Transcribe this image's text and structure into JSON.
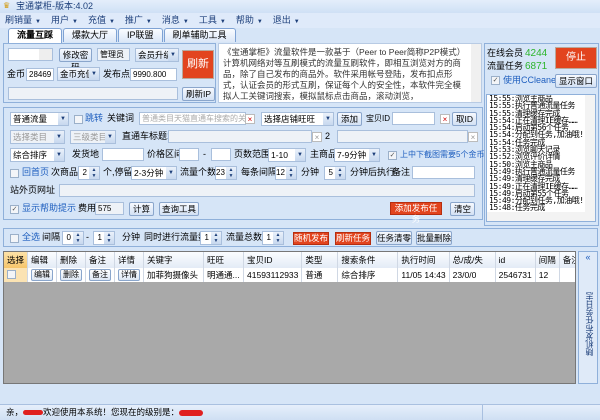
{
  "window": {
    "title": "宝通掌柜-版本:4.02"
  },
  "menu": [
    "刷销量",
    "用户",
    "充值",
    "推广",
    "消息",
    "工具",
    "帮助",
    "退出"
  ],
  "tabs": [
    "流量互踩",
    "爆款大厅",
    "IP联盟",
    "刷单辅助工具"
  ],
  "account": {
    "change_password": "修改密码",
    "role": "管理员",
    "upgrade": "会员升级",
    "refresh": "刷新",
    "coins_label": "金币",
    "coins": "28469",
    "recharge": "金币充值",
    "points_label": "发布点",
    "points": "9990.800",
    "refresh_ip": "刷新IP"
  },
  "info_text": "《宝通掌柜》流量软件是一款基于（Peer to Peer简称P2P模式）计算机网络对等互刷模式的流量互刷软件，即相互浏览对方的商品，除了自己发布的商品外。软件采用帐号登陆，发布扣点形式，认证会员的形式互刷，保证每个人的安全性，本软件完全模拟人工关键词搜索，模拟鼠标点击商品，滚动浏览，",
  "status_panel": {
    "online_label": "在线会员",
    "online": "4244",
    "tasks_label": "流量任务",
    "tasks": "6871",
    "stop": "停止",
    "use_ccleaner": "使用CCleaner",
    "show_window": "显示窗口"
  },
  "log": [
    "15:55:浏览主商品",
    "15:55:执行普通流量任务",
    "15:55:清理缓存完成",
    "15:54:正在清理IE缓存……",
    "15:54:启动第56个任务",
    "15:54:分配到任务,加油哦!",
    "15:54:任务完成",
    "15:53:浏览聊天记录",
    "15:52:浏览评价详情",
    "15:50:浏览主商品",
    "15:49:执行普通流量任务",
    "15:49:清理缓存完成",
    "15:49:正在清理IE缓存……",
    "15:49:启动第55个任务",
    "15:49:分配到任务,加油哦!",
    "15:48:任务完成"
  ],
  "form": {
    "traffic_type": "普通流量",
    "bounce_label": "跳转",
    "keyword_label": "关键词",
    "keyword_placeholder": "普通类目天猫直通车搜索的关键词",
    "shop_select": "选择店铺旺旺",
    "add": "添加",
    "item_id_label": "宝贝ID",
    "get_id": "取ID",
    "category": "选择类目",
    "sub_category": "三级类目",
    "ad_title_label": "直通车标题1",
    "ad_title2_label": "2",
    "sort": "综合排序",
    "ship_from_label": "发货地",
    "price_label": "价格区间",
    "price_sep": "-",
    "page_range_label": "页数范围",
    "page_range": "1-10",
    "main_item_label": "主商品",
    "main_item_time": "7-9分钟",
    "screenshot_label": "上中下截图需要5个金币",
    "return_home": "回首页",
    "sub_item_label": "次商品",
    "sub_item_count": "2",
    "stay_label": "个,停留",
    "stay_time": "2-3分钟",
    "flow_count_label": "流量个数",
    "flow_count": "23",
    "interval_label": "每条间隔",
    "interval": "12",
    "minutes_label": "分钟",
    "delay": "5",
    "delay_label": "分钟后执行",
    "note_label": "备注",
    "external_url_label": "站外页网址",
    "show_help": "显示帮助提示",
    "cost_label": "费用",
    "cost": "575",
    "calculate": "计算",
    "query_tool": "查询工具",
    "add_task": "添加发布任务",
    "clear": "清空"
  },
  "toolbar": {
    "select_all": "全选",
    "interval_label": "间隔",
    "from": "0",
    "sep": "-",
    "to": "1",
    "minutes": "分钟",
    "concurrent_label": "同时进行流量数",
    "concurrent": "1",
    "total_label": "流量总数",
    "total": "1",
    "random_publish": "随机发布",
    "refresh_tasks": "刷新任务",
    "clear_tasks": "任务清零",
    "batch_delete": "批量删除"
  },
  "table": {
    "headers": [
      "选择",
      "编辑",
      "删除",
      "备注",
      "详情",
      "关键字",
      "旺旺",
      "宝贝ID",
      "类型",
      "搜索条件",
      "执行时间",
      "总/成/失",
      "id",
      "间隔",
      "备注"
    ],
    "rows": [
      {
        "edit": "编辑",
        "delete": "删除",
        "note": "备注",
        "detail": "详情",
        "keyword": "加菲狗摄像头",
        "wangwang": "明通通...",
        "item_id": "41593112933",
        "type": "普通",
        "search": "综合排序",
        "time": "11/05 14:43",
        "stats": "23/0/0",
        "id": "2546731",
        "interval": "12",
        "remark": ""
      }
    ]
  },
  "side_tab": {
    "label": "随机发布任务日志",
    "collapse": "«"
  },
  "statusbar": {
    "prefix": "亲，",
    "welcome": "欢迎使用本系统！您现在的级别是："
  }
}
